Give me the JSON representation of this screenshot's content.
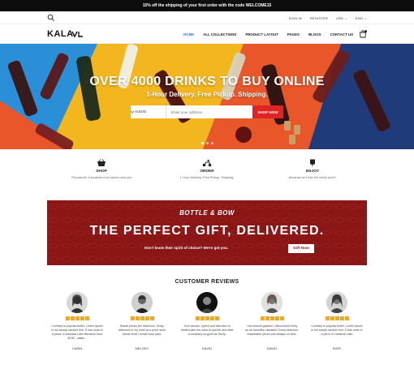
{
  "promo": {
    "text": "15% off the shipping of your first order with the code WELCOME15"
  },
  "util": {
    "sign_in": "SIGN IN",
    "register": "REGISTER",
    "currency": "USD ⌄",
    "language": "ENG ⌄"
  },
  "nav": {
    "logo": "KALA",
    "items": [
      {
        "label": "HOME",
        "active": true
      },
      {
        "label": "ALL COLLECTIONS"
      },
      {
        "label": "PRODUCT LAYOUT"
      },
      {
        "label": "PAGES"
      },
      {
        "label": "BLOGS"
      },
      {
        "label": "CONTACT US"
      }
    ],
    "cart_count": "0"
  },
  "hero": {
    "title": "OVER 4000 DRINKS TO BUY ONLINE",
    "subtitle": "1-Hour Delivery. Free Pickup. Shipping.",
    "select_value": "AUDIO",
    "address_placeholder": "Enter your address",
    "button": "SHOP NOW"
  },
  "features": [
    {
      "title": "SHOP",
      "desc": "Thousands of products from stores near you",
      "icon": "basket-icon"
    },
    {
      "title": "ORDER",
      "desc": "1-Hour Delivery. Free Pickup. Shipping.",
      "icon": "scooter-icon"
    },
    {
      "title": "ENJOY",
      "desc": "Because isn't that the whole point?",
      "icon": "glass-icon"
    }
  ],
  "banner": {
    "small": "BOTTLE & BOW",
    "big": "THE PERFECT GIFT, DELIVERED.",
    "line": "Don't know their spirit of choice? We're got you.",
    "button": "Gift Now"
  },
  "reviews": {
    "title": "CUSTOMER REVIEWS",
    "items": [
      {
        "name": "CARIN",
        "rating": 5,
        "text": "Contrary to popular belief, Lorem Ipsum is not simply random text. It has roots in a piece of classical Latin literature from 45 BC, makin..."
      },
      {
        "name": "MELODY",
        "rating": 5,
        "text": "Baxall prices are ridiculous. Drizly delivered to my hotel at a price much below what I would have paid."
      },
      {
        "name": "DAVID",
        "rating": 5,
        "text": "Your service, speed and attention to detail make me want to quit life and start a company as good as Drizly."
      },
      {
        "name": "DAVID",
        "rating": 5,
        "text": "I am forever grateful I discovered Drizly as an beautiful, fantastic! Great selection, reasonable prices and always on time."
      },
      {
        "name": "KATE",
        "rating": 5,
        "text": "Contrary to popular belief, Lorem Ipsum is not simply random text. It has roots in a piece of classical Latin"
      }
    ]
  },
  "colors": {
    "accent_red": "#e02323",
    "banner_red": "#8a1616",
    "nav_active": "#3a7bd5",
    "star": "#f5a623"
  }
}
